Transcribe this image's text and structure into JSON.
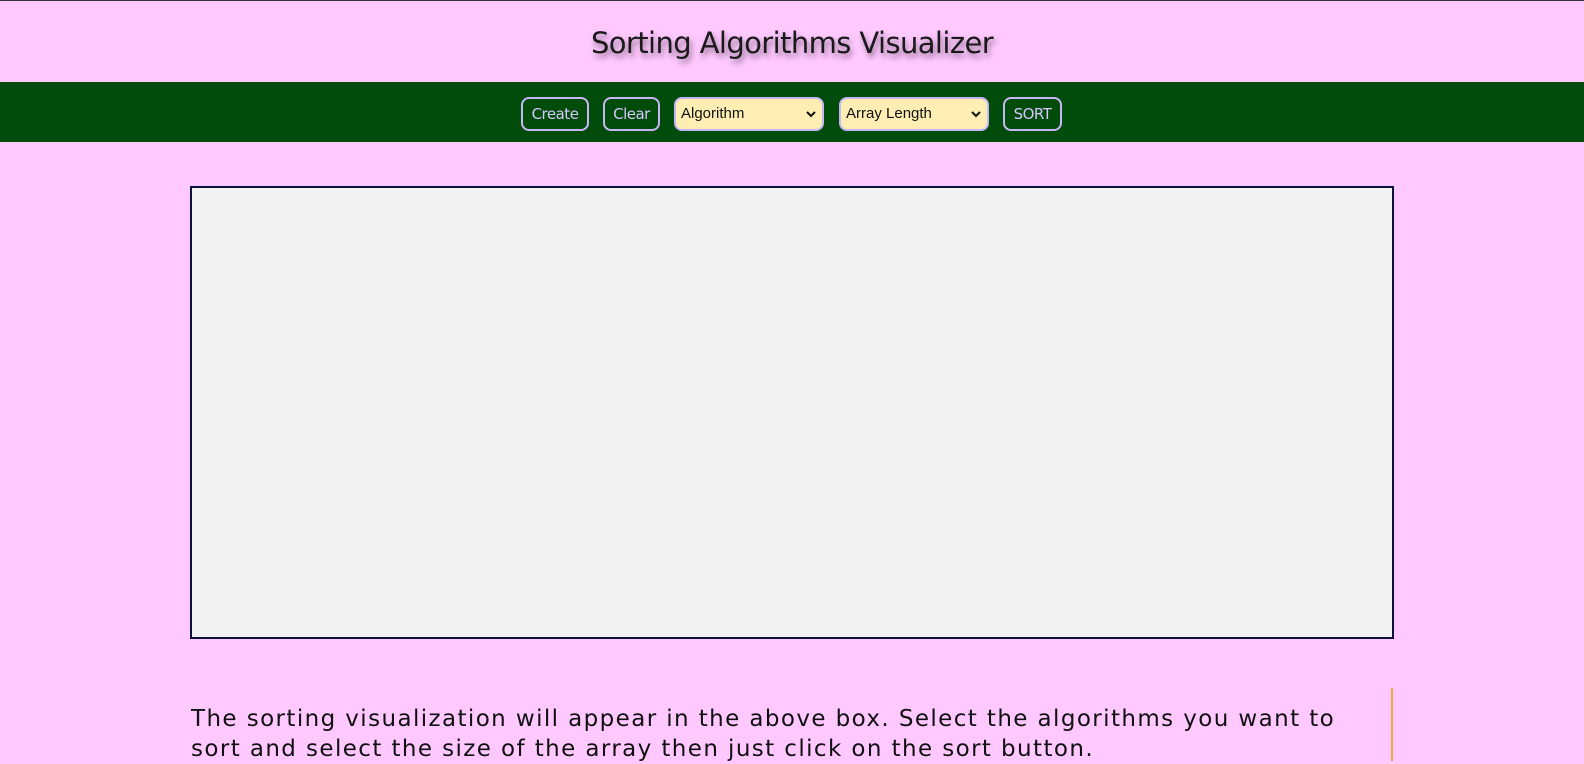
{
  "header": {
    "title": "Sorting Algorithms Visualizer"
  },
  "toolbar": {
    "create_label": "Create",
    "clear_label": "Clear",
    "algorithm_select": {
      "selected": "Algorithm",
      "icon": "chevron-down-icon"
    },
    "length_select": {
      "selected": "Array Length",
      "icon": "chevron-down-icon"
    },
    "sort_label": "SORT"
  },
  "main": {
    "description": "The sorting visualization will appear in the above box. Select the algorithms you want to sort and select the size of the array then just click on the sort button."
  },
  "colors": {
    "page_background": "#ffc8ff",
    "navbar_background": "#014c0b",
    "button_border": "#c7b6f5",
    "select_background": "#ffeeb4",
    "visualizer_background": "#f2f2f2",
    "visualizer_border": "#10103a",
    "accent_rule": "#f2a634"
  }
}
